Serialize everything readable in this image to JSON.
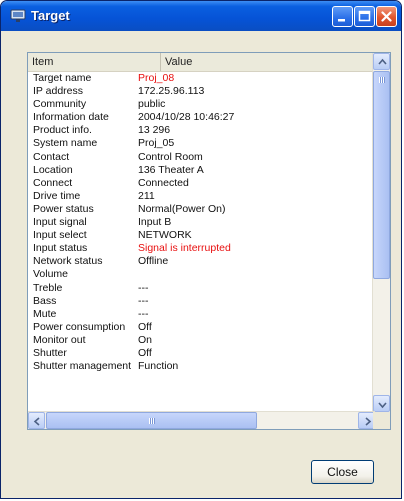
{
  "window": {
    "title": "Target"
  },
  "list": {
    "columns": [
      "Item",
      "Value"
    ],
    "rows": [
      {
        "item": "Target name",
        "value": "Proj_08",
        "highlight": true
      },
      {
        "item": "IP address",
        "value": "172.25.96.113"
      },
      {
        "item": "Community",
        "value": "public"
      },
      {
        "item": "Information date",
        "value": "2004/10/28 10:46:27"
      },
      {
        "item": "Product info.",
        "value": "13 296"
      },
      {
        "item": "System name",
        "value": "Proj_05"
      },
      {
        "item": "Contact",
        "value": "Control Room"
      },
      {
        "item": "Location",
        "value": "136 Theater A"
      },
      {
        "item": "Connect",
        "value": "Connected"
      },
      {
        "item": "Drive time",
        "value": "211"
      },
      {
        "item": "Power status",
        "value": "Normal(Power On)"
      },
      {
        "item": "Input signal",
        "value": "Input B"
      },
      {
        "item": "Input select",
        "value": "NETWORK"
      },
      {
        "item": "Input status",
        "value": "Signal is interrupted",
        "highlight": true
      },
      {
        "item": "Network status",
        "value": "Offline"
      },
      {
        "item": "Volume",
        "value": ""
      },
      {
        "item": "Treble",
        "value": "---"
      },
      {
        "item": "Bass",
        "value": "---"
      },
      {
        "item": "Mute",
        "value": "---"
      },
      {
        "item": "Power consumption",
        "value": "Off"
      },
      {
        "item": "Monitor out",
        "value": "On"
      },
      {
        "item": "Shutter",
        "value": "Off"
      },
      {
        "item": "Shutter management",
        "value": "Function"
      }
    ]
  },
  "buttons": {
    "close_label": "Close"
  },
  "colors": {
    "titlebar": "#0653d6",
    "highlight_text": "#e81010"
  },
  "icons": {
    "title_icon": "monitor-icon",
    "minimize": "minimize-icon",
    "maximize": "maximize-icon",
    "close": "close-icon"
  }
}
